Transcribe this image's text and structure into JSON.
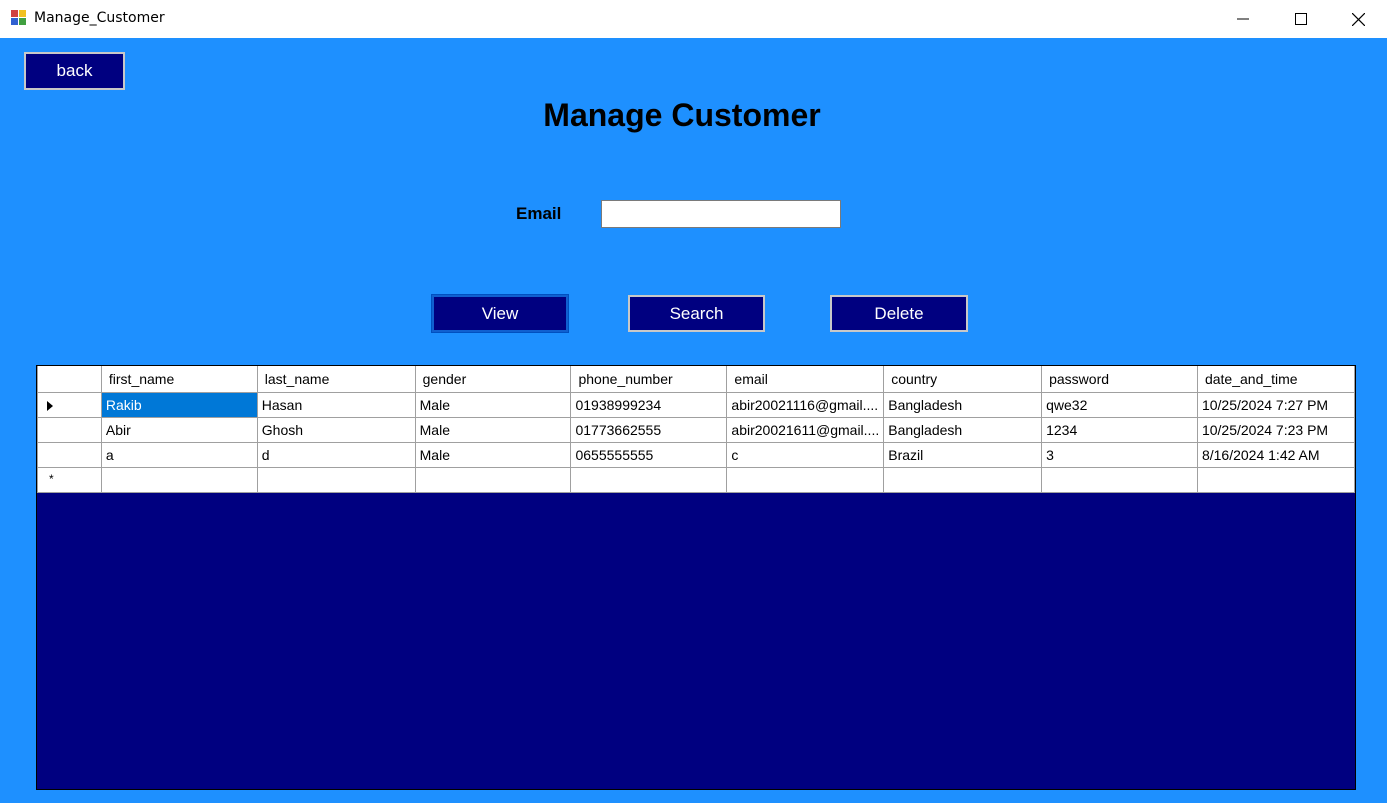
{
  "window": {
    "title": "Manage_Customer"
  },
  "header": {
    "back_label": "back",
    "title": "Manage Customer"
  },
  "form": {
    "email_label": "Email",
    "email_value": ""
  },
  "actions": {
    "view_label": "View",
    "search_label": "Search",
    "delete_label": "Delete"
  },
  "grid": {
    "columns": [
      "first_name",
      "last_name",
      "gender",
      "phone_number",
      "email",
      "country",
      "password",
      "date_and_time"
    ],
    "rows": [
      [
        "Rakib",
        "Hasan",
        "Male",
        "01938999234",
        "abir20021116@gmail....",
        "Bangladesh",
        "qwe32",
        "10/25/2024 7:27 PM"
      ],
      [
        "Abir",
        "Ghosh",
        "Male",
        "01773662555",
        "abir20021611@gmail....",
        "Bangladesh",
        "1234",
        "10/25/2024 7:23 PM"
      ],
      [
        "a",
        "d",
        "Male",
        "0655555555",
        "c",
        "Brazil",
        "3",
        "8/16/2024 1:42 AM"
      ]
    ],
    "current_row_marker": "arrow",
    "new_row_marker": "*"
  },
  "colors": {
    "form_background": "#1e90ff",
    "button_background": "#000080",
    "grid_background": "#000080",
    "selection": "#0078d7"
  }
}
